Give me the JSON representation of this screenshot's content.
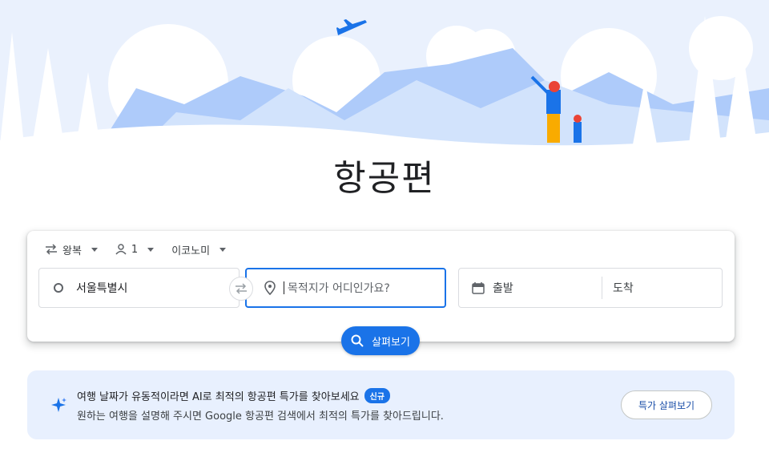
{
  "page": {
    "title": "항공편"
  },
  "trip_options": {
    "trip_type": "왕복",
    "passengers": "1",
    "cabin_class": "이코노미"
  },
  "search": {
    "origin": "서울특별시",
    "destination_placeholder": "목적지가 어디인가요?",
    "departure_label": "출발",
    "arrival_label": "도착",
    "button_label": "살펴보기"
  },
  "promo": {
    "title": "여행 날짜가 유동적이라면 AI로 최적의 항공편 특가를 찾아보세요",
    "badge": "신규",
    "subtitle": "원하는 여행을 설명해 주시면 Google 항공편 검색에서 최적의 특가를 찾아드립니다.",
    "button_label": "특가 살펴보기"
  },
  "colors": {
    "accent": "#1a73e8",
    "promo_background": "#e8f0fe",
    "illustration_blue": "#aecbfa"
  },
  "icons": [
    "airplane-icon",
    "swap-arrows-icon",
    "person-icon",
    "location-pin-icon",
    "calendar-icon",
    "search-icon",
    "sparkle-icon"
  ]
}
